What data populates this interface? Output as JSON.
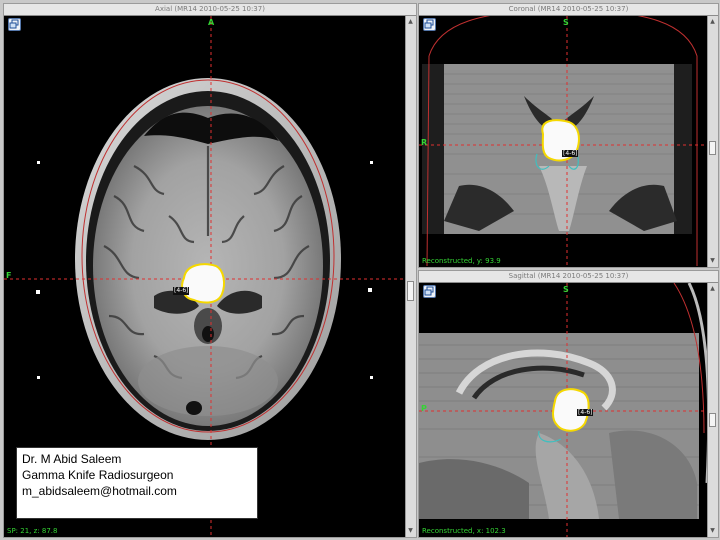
{
  "axial": {
    "title": "Axial (MR14 2010-05-25 10:37)",
    "orientation_top": "A",
    "orientation_left": "F",
    "status": "SP: 21, z: 87.8",
    "target_label": "[4-6]"
  },
  "coronal": {
    "title": "Coronal (MR14 2010-05-25 10:37)",
    "orientation_top": "S",
    "orientation_left": "R",
    "status": "Reconstructed, y: 93.9",
    "target_label": "[4-6]"
  },
  "sagittal": {
    "title": "Sagittal (MR14 2010-05-25 10:37)",
    "orientation_top": "S",
    "orientation_left": "P",
    "status": "Reconstructed, x: 102.3",
    "target_label": "[4-6]"
  },
  "info": {
    "name": "Dr. M Abid Saleem",
    "role": "Gamma Knife Radiosurgeon",
    "email": "m_abidsaleem@hotmail.com"
  },
  "colors": {
    "crosshair": "#e03030",
    "contour_outer": "#f5d800",
    "contour_inner": "#ffffff",
    "aux_contour": "#3fbfbf",
    "orientation_text": "#34d434"
  },
  "icons": {
    "tool_button": "window-restore-icon",
    "scroll_up": "arrow-up-icon",
    "scroll_down": "arrow-down-icon"
  }
}
